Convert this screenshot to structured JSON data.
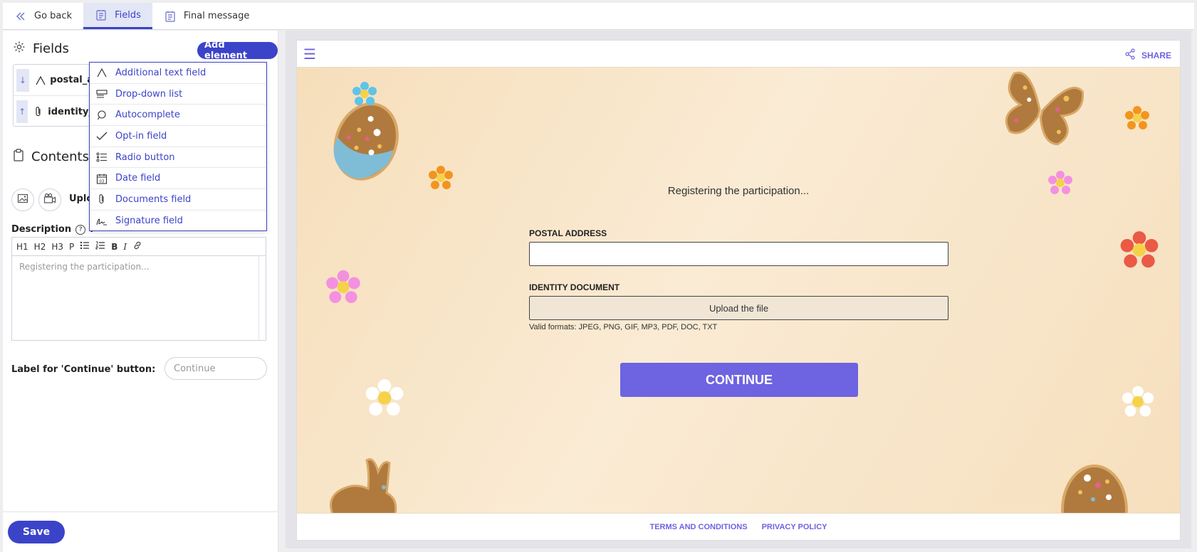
{
  "topbar": {
    "go_back": "Go back",
    "tabs": [
      {
        "label": "Fields",
        "active": true
      },
      {
        "label": "Final message",
        "active": false
      }
    ]
  },
  "left": {
    "fields_title": "Fields",
    "add_element": "Add element",
    "field_rows": [
      {
        "name": "postal_a",
        "icon": "text-field-icon",
        "arrow": "↓"
      },
      {
        "name": "identity_",
        "icon": "paperclip-icon",
        "arrow": "↑"
      }
    ],
    "contents_title": "Contents",
    "upload_label": "Uplo",
    "description_label": "Description",
    "description_colon": ":",
    "help_symbol": "?",
    "toolbar": [
      "H1",
      "H2",
      "H3",
      "P"
    ],
    "toolbar_b": "B",
    "toolbar_i": "I",
    "description_value": "Registering the participation...",
    "continue_label": "Label for 'Continue' button:",
    "continue_placeholder": "Continue",
    "save": "Save"
  },
  "dropdown": {
    "items": [
      {
        "label": "Additional text field",
        "icon": "text-field-icon"
      },
      {
        "label": "Drop-down list",
        "icon": "dropdown-list-icon"
      },
      {
        "label": "Autocomplete",
        "icon": "autocomplete-icon"
      },
      {
        "label": "Opt-in field",
        "icon": "checkmark-icon"
      },
      {
        "label": "Radio button",
        "icon": "radio-list-icon"
      },
      {
        "label": "Date field",
        "icon": "calendar-icon"
      },
      {
        "label": "Documents field",
        "icon": "paperclip-icon"
      },
      {
        "label": "Signature field",
        "icon": "signature-icon"
      }
    ]
  },
  "preview": {
    "share": "SHARE",
    "heading": "Registering the participation...",
    "postal_label": "POSTAL ADDRESS",
    "identity_label": "IDENTITY DOCUMENT",
    "upload_text": "Upload the file",
    "formats": "Valid formats: JPEG, PNG, GIF, MP3, PDF, DOC, TXT",
    "continue": "CONTINUE",
    "terms": "TERMS AND CONDITIONS",
    "privacy": "PRIVACY POLICY"
  },
  "colors": {
    "accent": "#3b43c9",
    "preview_accent": "#6e63e0",
    "preview_bg": "#f7e2c4"
  }
}
